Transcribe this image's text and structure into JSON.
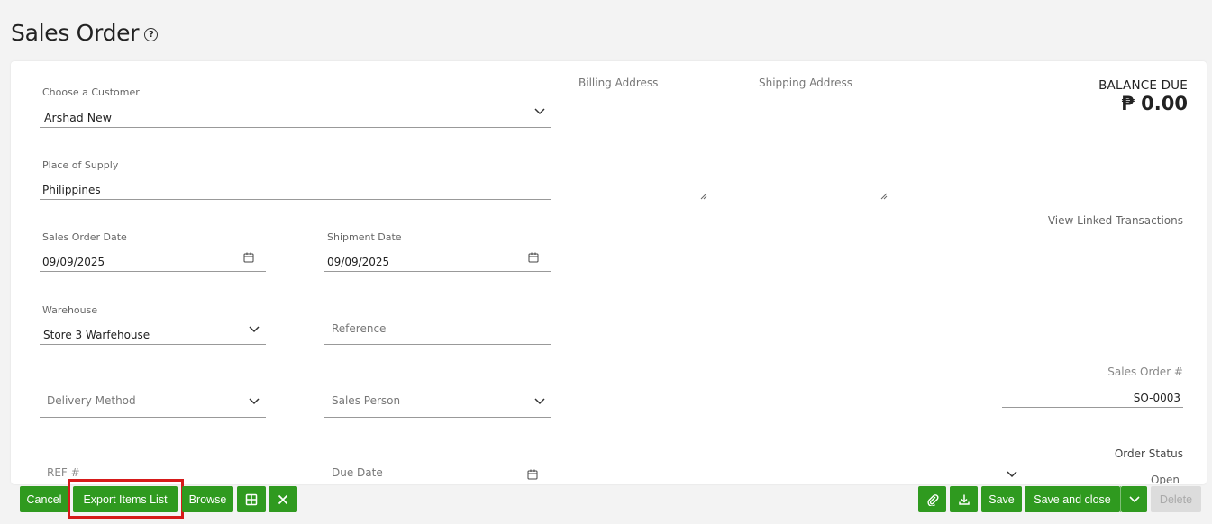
{
  "page": {
    "title": "Sales Order",
    "help_icon": "question-circle-icon"
  },
  "customer": {
    "label": "Choose a Customer",
    "value": "Arshad New"
  },
  "place_of_supply": {
    "label": "Place of Supply",
    "value": "Philippines"
  },
  "sales_order_date": {
    "label": "Sales Order Date",
    "value": "09/09/2025"
  },
  "shipment_date": {
    "label": "Shipment Date",
    "value": "09/09/2025"
  },
  "warehouse": {
    "label": "Warehouse",
    "value": "Store 3 Warfehouse"
  },
  "reference": {
    "placeholder": "Reference"
  },
  "delivery_method": {
    "placeholder": "Delivery Method"
  },
  "sales_person": {
    "placeholder": "Sales Person"
  },
  "ref_no": {
    "placeholder": "REF #"
  },
  "due_date": {
    "placeholder": "Due Date"
  },
  "billing_address": {
    "label": "Billing Address"
  },
  "shipping_address": {
    "label": "Shipping Address"
  },
  "balance": {
    "label": "BALANCE DUE",
    "value": "₱ 0.00"
  },
  "linked_transactions": {
    "label": "View Linked Transactions"
  },
  "sales_order_no": {
    "label": "Sales Order #",
    "value": "SO-0003"
  },
  "order_status": {
    "label": "Order Status",
    "value": "Open"
  },
  "toolbar": {
    "cancel": "Cancel",
    "export_items": "Export Items List",
    "browse": "Browse",
    "grid_icon": "grid-icon",
    "close_icon": "close-icon",
    "attach_icon": "paperclip-icon",
    "download_icon": "download-icon",
    "save": "Save",
    "save_and_close": "Save and close",
    "delete": "Delete"
  },
  "colors": {
    "primary": "#2f9a1f",
    "highlight": "#d61a1a",
    "disabled": "#dcdcdc"
  }
}
